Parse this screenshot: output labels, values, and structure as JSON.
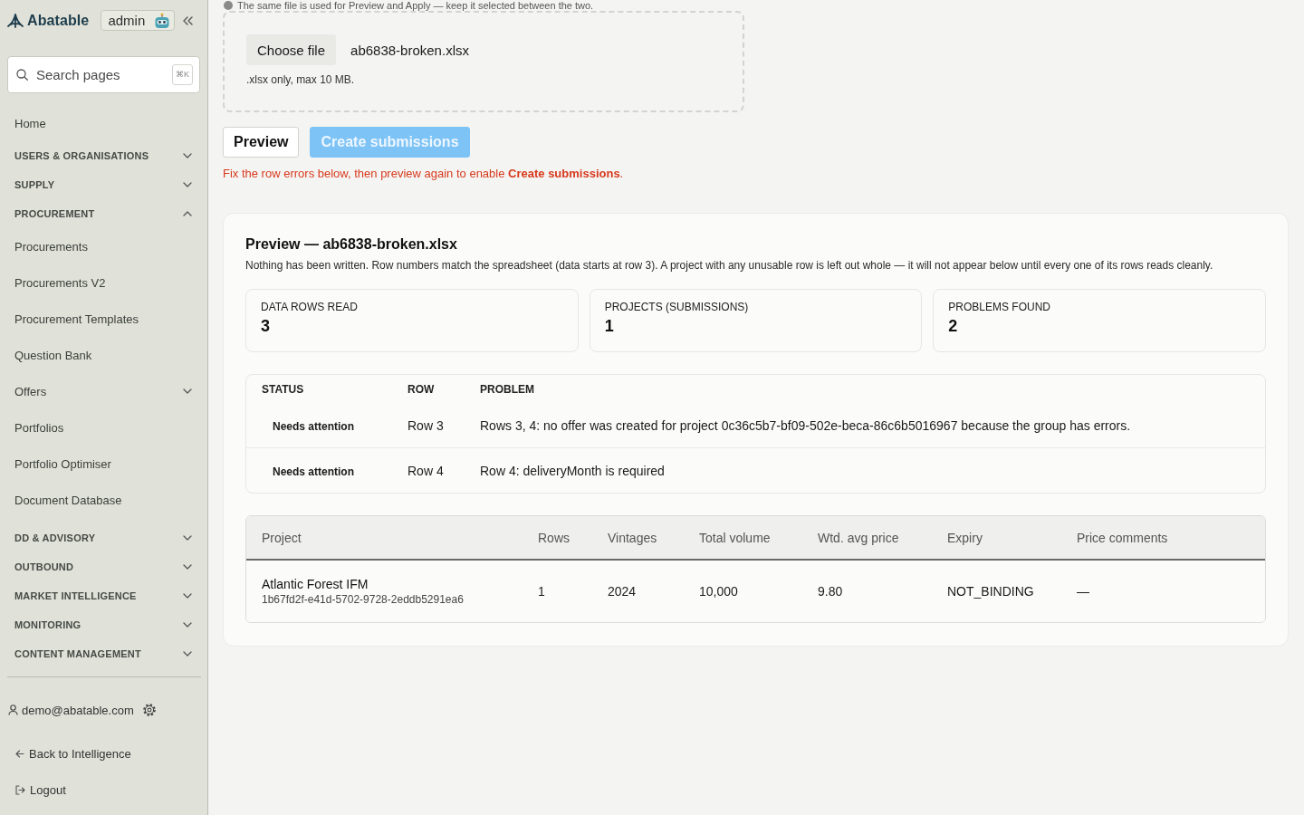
{
  "sidebar": {
    "brand": "Abatable",
    "role_badge": "admin",
    "search": {
      "placeholder": "Search pages",
      "shortcut": "⌘K"
    },
    "nav": [
      {
        "kind": "link",
        "label": "Home"
      },
      {
        "kind": "section",
        "label": "USERS & ORGANISATIONS",
        "expanded": false
      },
      {
        "kind": "section",
        "label": "SUPPLY",
        "expanded": false
      },
      {
        "kind": "section",
        "label": "PROCUREMENT",
        "expanded": true,
        "children": [
          {
            "kind": "link",
            "label": "Procurements"
          },
          {
            "kind": "link",
            "label": "Procurements V2"
          },
          {
            "kind": "link",
            "label": "Procurement Templates"
          },
          {
            "kind": "link",
            "label": "Question Bank"
          },
          {
            "kind": "group",
            "label": "Offers",
            "expanded": false
          },
          {
            "kind": "link",
            "label": "Portfolios"
          },
          {
            "kind": "link",
            "label": "Portfolio Optimiser"
          },
          {
            "kind": "link",
            "label": "Document Database"
          }
        ]
      },
      {
        "kind": "section",
        "label": "DD & ADVISORY",
        "expanded": false
      },
      {
        "kind": "section",
        "label": "OUTBOUND",
        "expanded": false
      },
      {
        "kind": "section",
        "label": "MARKET INTELLIGENCE",
        "expanded": false
      },
      {
        "kind": "section",
        "label": "MONITORING",
        "expanded": false
      },
      {
        "kind": "section",
        "label": "CONTENT MANAGEMENT",
        "expanded": false
      }
    ],
    "user_email": "demo@abatable.com",
    "footer_links": [
      {
        "kind": "back",
        "label": "Back to Intelligence"
      },
      {
        "kind": "logout",
        "label": "Logout"
      }
    ]
  },
  "notice": "The same file is used for Preview and Apply — keep it selected between the two.",
  "upload": {
    "button": "Choose file",
    "file_name": "ab6838-broken.xlsx",
    "hint": ".xlsx only, max 10 MB."
  },
  "actions": [
    {
      "kind": "secondary",
      "label": "Preview",
      "disabled": false
    },
    {
      "kind": "primary",
      "label": "Create submissions",
      "disabled": true
    }
  ],
  "error_message": "Fix the row errors below, then preview again to enable **Create submissions**.",
  "preview": {
    "title": "Preview — ab6838-broken.xlsx",
    "description": "Nothing has been written. Row numbers match the spreadsheet (data starts at row 3). A project with any unusable row is left out whole — it will not appear below until every one of its rows reads cleanly.",
    "stats": [
      {
        "label": "DATA ROWS READ",
        "value": "3"
      },
      {
        "label": "PROJECTS (SUBMISSIONS)",
        "value": "1"
      },
      {
        "label": "PROBLEMS FOUND",
        "value": "2"
      }
    ],
    "problems": {
      "columns": [
        "STATUS",
        "ROW",
        "PROBLEM"
      ],
      "rows": [
        {
          "status": "Needs attention",
          "row": "Row 3",
          "problem": "Rows 3, 4: no offer was created for project 0c36c5b7-bf09-502e-beca-86c6b5016967 because the group has errors."
        },
        {
          "status": "Needs attention",
          "row": "Row 4",
          "problem": "Row 4: deliveryMonth is required"
        }
      ]
    },
    "projects": {
      "columns": [
        "Project",
        "Rows",
        "Vintages",
        "Total volume",
        "Wtd. avg price",
        "Expiry",
        "Price comments"
      ],
      "rows": [
        {
          "cells": [
            {
              "title": "Atlantic Forest IFM",
              "subtitle": "1b67fd2f-e41d-5702-9728-2eddb5291ea6"
            },
            "1",
            "2024",
            "10,000",
            "9.80",
            "NOT_BINDING",
            "—"
          ]
        }
      ]
    }
  }
}
